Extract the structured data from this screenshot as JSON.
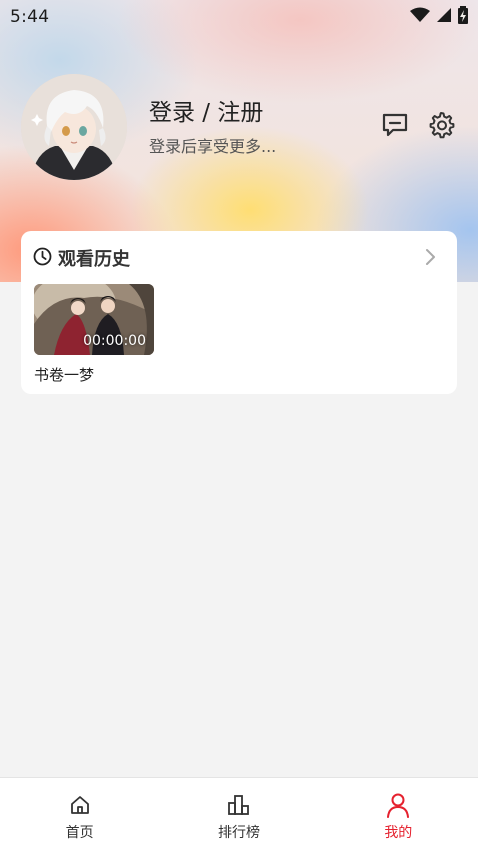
{
  "status_bar": {
    "time": "5:44"
  },
  "profile": {
    "title": "登录 / 注册",
    "subtitle": "登录后享受更多..."
  },
  "history": {
    "title": "观看历史",
    "items": [
      {
        "title": "书卷一梦",
        "duration": "00:00:00"
      }
    ]
  },
  "bottom_nav": {
    "items": [
      {
        "label": "首页",
        "icon": "home-icon",
        "active": false
      },
      {
        "label": "排行榜",
        "icon": "ranking-icon",
        "active": false
      },
      {
        "label": "我的",
        "icon": "user-icon",
        "active": true
      }
    ]
  },
  "colors": {
    "accent": "#e5212e",
    "background": "#f3f3f3",
    "card": "#ffffff"
  }
}
